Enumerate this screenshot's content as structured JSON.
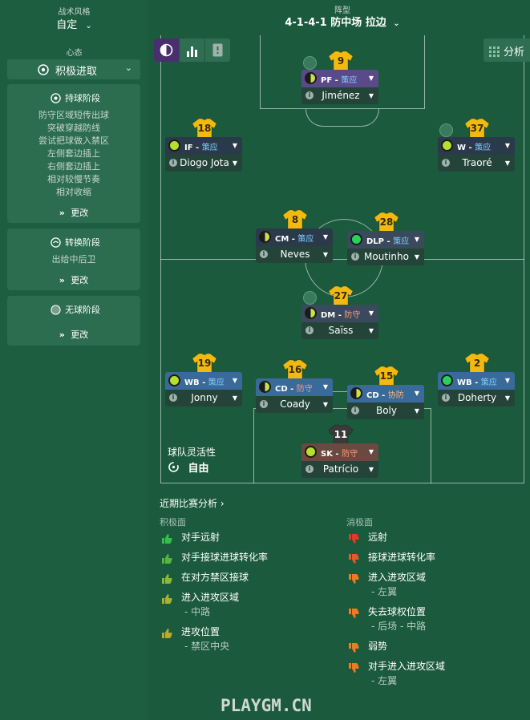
{
  "sidebar": {
    "style_label": "战术风格",
    "style_value": "自定",
    "mentality_label": "心态",
    "mentality_value": "积极进取",
    "in_possession": {
      "title": "持球阶段",
      "lines": [
        "防守区域短传出球",
        "突破穿越防线",
        "尝试把球做入禁区",
        "左侧套边插上",
        "右侧套边插上",
        "相对较慢节奏",
        "相对收缩"
      ],
      "change": "更改"
    },
    "transition": {
      "title": "转换阶段",
      "lines": [
        "出给中后卫"
      ],
      "change": "更改"
    },
    "out_possession": {
      "title": "无球阶段",
      "change": "更改"
    }
  },
  "main": {
    "formation_label": "阵型",
    "formation_value": "4-1-4-1 防中场 拉边",
    "analysis_button": "分析",
    "team_fluidity_label": "球队灵活性",
    "team_fluidity_value": "自由",
    "players": [
      {
        "id": "st",
        "number": "9",
        "role": "PF",
        "duty": "策应",
        "name": "Jiménez",
        "dot": "half",
        "bg": "#5a4a8a",
        "indicator": true
      },
      {
        "id": "lw",
        "number": "18",
        "role": "IF",
        "duty": "策应",
        "name": "Diogo Jota",
        "dot": "lime",
        "bg": "#2a3a4a",
        "indicator": false
      },
      {
        "id": "rw",
        "number": "37",
        "role": "W",
        "duty": "策应",
        "name": "Traoré",
        "dot": "lime",
        "bg": "#2a3a4a",
        "indicator": true
      },
      {
        "id": "lcm",
        "number": "8",
        "role": "CM",
        "duty": "策应",
        "name": "Neves",
        "dot": "half",
        "bg": "#2a3a4a",
        "indicator": false
      },
      {
        "id": "rcm",
        "number": "28",
        "role": "DLP",
        "duty": "策应",
        "name": "Moutinho",
        "dot": "green",
        "bg": "#3a4a5c",
        "indicator": false
      },
      {
        "id": "dm",
        "number": "27",
        "role": "DM",
        "duty": "防守",
        "name": "Saïss",
        "dot": "half",
        "bg": "#3a4a5c",
        "indicator": true
      },
      {
        "id": "lb",
        "number": "19",
        "role": "WB",
        "duty": "策应",
        "name": "Jonny",
        "dot": "lime",
        "bg": "#3a6a9a",
        "indicator": false
      },
      {
        "id": "lcb",
        "number": "16",
        "role": "CD",
        "duty": "防守",
        "name": "Coady",
        "dot": "half",
        "bg": "#3a6a9a",
        "indicator": false
      },
      {
        "id": "rcb",
        "number": "15",
        "role": "CD",
        "duty": "协防",
        "name": "Boly",
        "dot": "half",
        "bg": "#3a6a9a",
        "indicator": false
      },
      {
        "id": "rb",
        "number": "2",
        "role": "WB",
        "duty": "策应",
        "name": "Doherty",
        "dot": "green",
        "bg": "#3a6a9a",
        "indicator": false
      },
      {
        "id": "gk",
        "number": "11",
        "role": "SK",
        "duty": "防守",
        "name": "Patrício",
        "dot": "lime",
        "bg": "#6a4a40",
        "indicator": false
      }
    ]
  },
  "analysis": {
    "title": "近期比赛分析",
    "positive_label": "积极面",
    "negative_label": "消极面",
    "positives": [
      {
        "text": "对手远射",
        "sub": "",
        "color": "#2fc24a"
      },
      {
        "text": "对手接球进球转化率",
        "sub": "",
        "color": "#55b83c"
      },
      {
        "text": "在对方禁区接球",
        "sub": "",
        "color": "#8fb832"
      },
      {
        "text": "进入进攻区域",
        "sub": "- 中路",
        "color": "#a8b22c"
      },
      {
        "text": "进攻位置",
        "sub": "- 禁区中央",
        "color": "#b8aa2a"
      }
    ],
    "negatives": [
      {
        "text": "远射",
        "sub": "",
        "color": "#e03a2a"
      },
      {
        "text": "接球进球转化率",
        "sub": "",
        "color": "#e65a2a"
      },
      {
        "text": "进入进攻区域",
        "sub": "- 左翼",
        "color": "#ee7a22"
      },
      {
        "text": "失去球权位置",
        "sub": "- 后场 - 中路",
        "color": "#ee7a22"
      },
      {
        "text": "弱势",
        "sub": "",
        "color": "#ee7a22"
      },
      {
        "text": "对手进入进攻区域",
        "sub": "- 左翼",
        "color": "#ee7a22"
      }
    ]
  },
  "watermark": "PLAYGM.CN"
}
